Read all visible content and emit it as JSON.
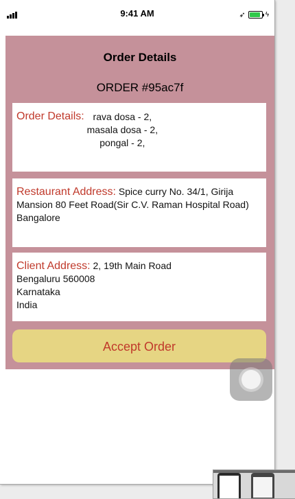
{
  "status_bar": {
    "time": "9:41 AM",
    "location_icon": "location-arrow-icon",
    "battery_level": 0.9,
    "battery_color": "#2fc94a"
  },
  "header": {
    "title": "Order Details",
    "order_id": "ORDER #95ac7f"
  },
  "order_details": {
    "label": "Order Details:",
    "items": [
      "rava dosa - 2,",
      "masala dosa - 2,",
      "pongal - 2,"
    ]
  },
  "restaurant": {
    "label": "Restaurant Address:",
    "address": "Spice curry No. 34/1, Girija Mansion 80 Feet Road(Sir C.V. Raman Hospital Road) Bangalore"
  },
  "client": {
    "label": "Client Address:",
    "line1": "2, 19th Main Road",
    "line2": "Bengaluru 560008",
    "line3": "Karnataka",
    "line4": "India"
  },
  "actions": {
    "accept_label": "Accept Order"
  },
  "colors": {
    "content_bg": "#c5919a",
    "label": "#c0392b",
    "accept_bg": "#e6d583"
  }
}
